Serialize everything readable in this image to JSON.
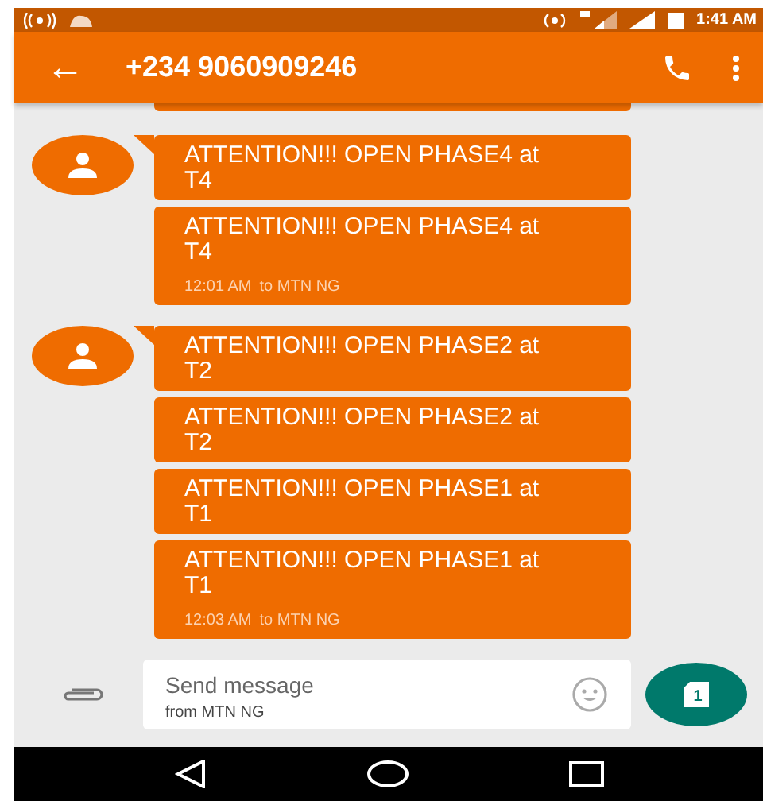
{
  "status_bar": {
    "time": "1:41 AM"
  },
  "app_bar": {
    "back": "←",
    "title": "+234 9060909246"
  },
  "groups": [
    {
      "messages": [
        {
          "text": "ATTENTION!!! OPEN PHASE4 at T4"
        },
        {
          "text": "ATTENTION!!! OPEN PHASE4 at T4",
          "time": "12:01 AM",
          "recipient": "to MTN NG"
        }
      ]
    },
    {
      "messages": [
        {
          "text": "ATTENTION!!! OPEN PHASE2 at T2"
        },
        {
          "text": "ATTENTION!!! OPEN PHASE2 at T2"
        },
        {
          "text": "ATTENTION!!! OPEN PHASE1 at T1"
        },
        {
          "text": "ATTENTION!!! OPEN PHASE1 at T1",
          "time": "12:03 AM",
          "recipient": "to MTN NG"
        }
      ]
    }
  ],
  "composer": {
    "placeholder": "Send message",
    "subtitle": "from MTN NG",
    "sim": "1"
  }
}
